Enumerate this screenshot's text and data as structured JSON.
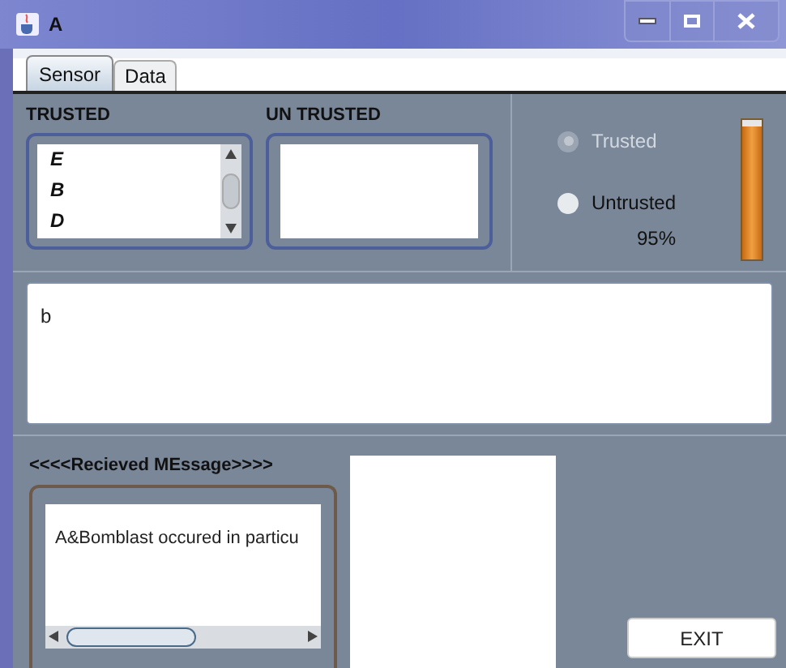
{
  "window": {
    "title": "A"
  },
  "tabs": [
    {
      "label": "Sensor",
      "selected": true
    },
    {
      "label": "Data",
      "selected": false
    }
  ],
  "trusted": {
    "label": "TRUSTED",
    "items": [
      "E",
      "B",
      "D"
    ]
  },
  "untrusted": {
    "label": "UN TRUSTED"
  },
  "radios": [
    {
      "label": "Trusted",
      "selected": true,
      "disabled": true
    },
    {
      "label": "Untrusted",
      "selected": false,
      "disabled": false
    }
  ],
  "percent": "95%",
  "meter": {
    "level": 0.95
  },
  "input_area": {
    "value": "b"
  },
  "received": {
    "label": "<<<<Recieved MEssage>>>>",
    "text": "A&Bomblast occured in particu"
  },
  "exit_button": "EXIT"
}
